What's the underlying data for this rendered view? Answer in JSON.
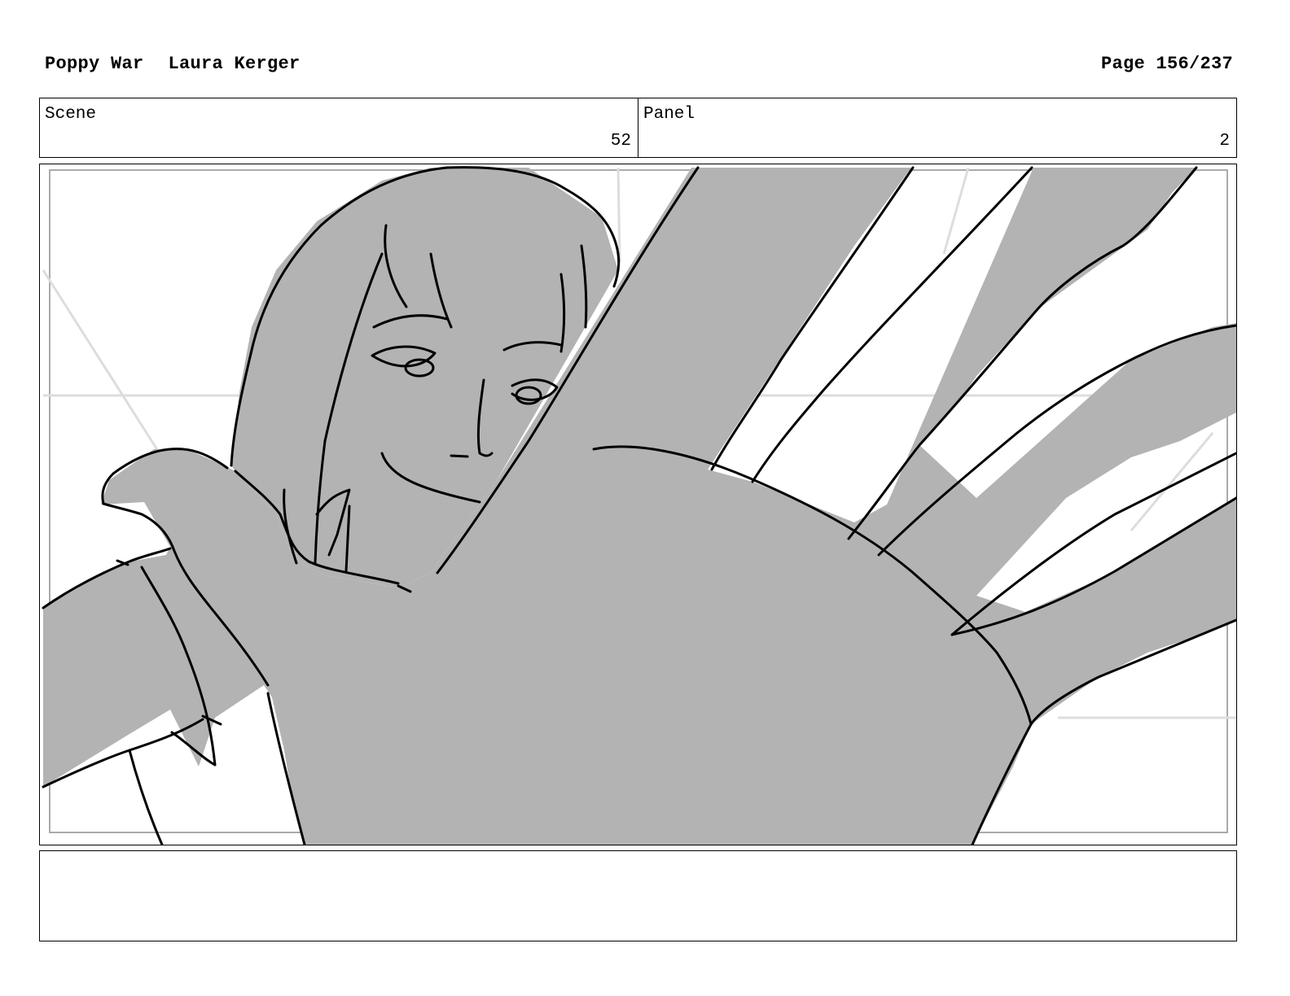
{
  "header": {
    "project": "Poppy War",
    "artist": "Laura Kerger",
    "page": "Page 156/237"
  },
  "scene": {
    "label": "Scene",
    "number": "52"
  },
  "panel": {
    "label": "Panel",
    "number": "2"
  },
  "notes": {
    "text": ""
  },
  "colors": {
    "fill": "#b3b3b3",
    "line": "#000000",
    "guide": "#d9d9d9"
  }
}
